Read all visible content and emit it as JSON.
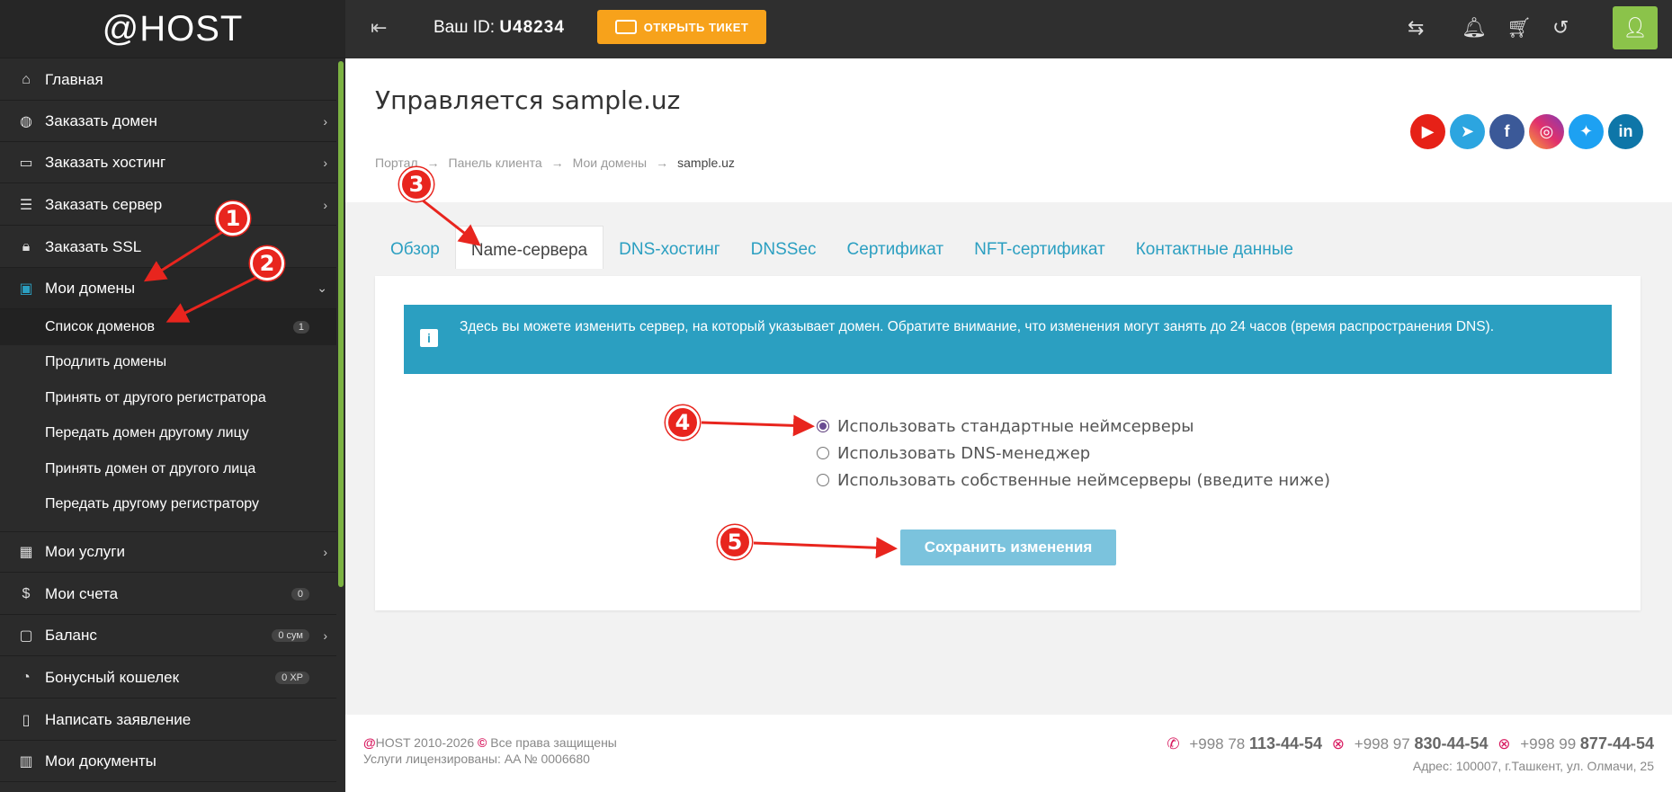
{
  "logo": "@HOST",
  "sidebar": {
    "items": [
      {
        "label": "Главная",
        "icon": "home-icon"
      },
      {
        "label": "Заказать домен",
        "icon": "globe-icon"
      },
      {
        "label": "Заказать хостинг",
        "icon": "drive-icon"
      },
      {
        "label": "Заказать сервер",
        "icon": "server-icon"
      },
      {
        "label": "Заказать SSL",
        "icon": "lock-icon"
      },
      {
        "label": "Мои домены",
        "icon": "domain-icon"
      },
      {
        "label": "Мои услуги",
        "icon": "box-icon"
      },
      {
        "label": "Мои счета",
        "icon": "invoice-icon",
        "badge": "0"
      },
      {
        "label": "Баланс",
        "icon": "wallet-icon",
        "badge": "0 сум"
      },
      {
        "label": "Бонусный кошелек",
        "icon": "piggy-bank-icon",
        "badge": "0 XP"
      },
      {
        "label": "Написать заявление",
        "icon": "document-icon"
      },
      {
        "label": "Мои документы",
        "icon": "books-icon"
      }
    ],
    "domain_submenu": [
      {
        "label": "Список доменов",
        "badge": "1"
      },
      {
        "label": "Продлить домены"
      },
      {
        "label": "Принять от другого регистратора"
      },
      {
        "label": "Передать домен другому лицу"
      },
      {
        "label": "Принять домен от другого лица"
      },
      {
        "label": "Передать другому регистратору"
      }
    ]
  },
  "topbar": {
    "id_label": "Ваш ID:",
    "id_value": "U48234",
    "ticket_button": "ОТКРЫТЬ ТИКЕТ"
  },
  "page": {
    "title": "Управляется sample.uz",
    "breadcrumb": [
      "Портал",
      "Панель клиента",
      "Мои домены",
      "sample.uz"
    ],
    "tabs": [
      "Обзор",
      "Name-сервера",
      "DNS-хостинг",
      "DNSSec",
      "Сертификат",
      "NFT-сертификат",
      "Контактные данные"
    ],
    "alert": "Здесь вы можете изменить сервер, на который указывает домен. Обратите внимание, что изменения могут занять до 24 часов (время распространения DNS).",
    "radio_options": [
      "Использовать стандартные неймсерверы",
      "Использовать DNS-менеджер",
      "Использовать собственные неймсерверы (введите ниже)"
    ],
    "save_button": "Сохранить изменения"
  },
  "socials": [
    "youtube",
    "telegram",
    "facebook",
    "instagram",
    "twitter",
    "linkedin"
  ],
  "footer": {
    "brand": "@",
    "copyright": "HOST 2010-2026",
    "rights": "Все права защищены",
    "license": "Услуги лицензированы: AA № 0006680",
    "phone1_prefix": "+998 78",
    "phone1_num": "113-44-54",
    "phone2_prefix": "+998 97",
    "phone2_num": "830-44-54",
    "phone3_prefix": "+998 99",
    "phone3_num": "877-44-54",
    "address": "Адрес: 100007, г.Ташкент, ул. Олмачи, 25"
  },
  "annotations": [
    "1",
    "2",
    "3",
    "4",
    "5"
  ],
  "colors": {
    "accent": "#2b9fc1",
    "ticket": "#f7a21b",
    "user_button": "#8bc34a",
    "marker": "#e8251e"
  }
}
